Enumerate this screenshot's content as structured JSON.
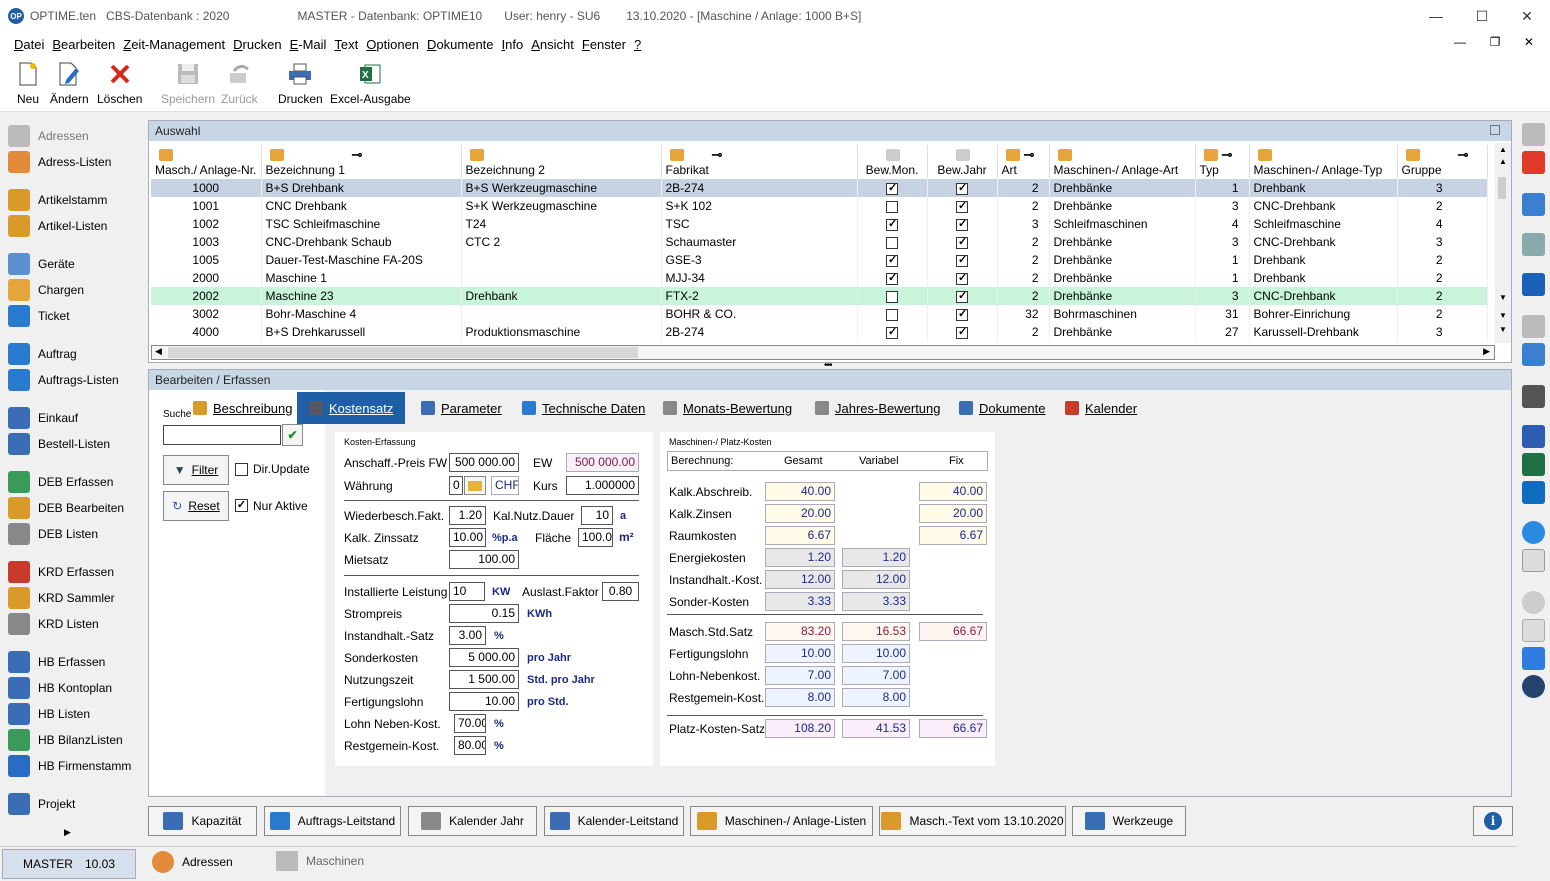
{
  "window": {
    "app": "OPTIME.ten",
    "db": "CBS-Datenbank : 2020",
    "master": "MASTER - Datenbank:  OPTIME10",
    "user": "User:  henry  -  SU6",
    "info": "13.10.2020 - [Maschine / Anlage: 1000  B+S]"
  },
  "menu": [
    "Datei",
    "Bearbeiten",
    "Zeit-Management",
    "Drucken",
    "E-Mail",
    "Text",
    "Optionen",
    "Dokumente",
    "Info",
    "Ansicht",
    "Fenster",
    "?"
  ],
  "toolbar": {
    "neu": "Neu",
    "aendern": "Ändern",
    "loeschen": "Löschen",
    "speichern": "Speichern",
    "zurueck": "Zurück",
    "drucken": "Drucken",
    "excel": "Excel-Ausgabe"
  },
  "sidebar": [
    "Adressen",
    "Adress-Listen",
    "Artikelstamm",
    "Artikel-Listen",
    "Geräte",
    "Chargen",
    "Ticket",
    "Auftrag",
    "Auftrags-Listen",
    "Einkauf",
    "Bestell-Listen",
    "DEB Erfassen",
    "DEB Bearbeiten",
    "DEB Listen",
    "KRD Erfassen",
    "KRD Sammler",
    "KRD Listen",
    "HB Erfassen",
    "HB Kontoplan",
    "HB Listen",
    "HB BilanzListen",
    "HB Firmenstamm",
    "Projekt"
  ],
  "auswahl": {
    "title": "Auswahl",
    "columns": [
      "Masch./ Anlage-Nr.",
      "Bezeichnung 1",
      "Bezeichnung 2",
      "Fabrikat",
      "Bew.Mon.",
      "Bew.Jahr",
      "Art",
      "Maschinen-/ Anlage-Art",
      "Typ",
      "Maschinen-/ Anlage-Typ",
      "Gruppe"
    ],
    "rows": [
      [
        "1000",
        "B+S Drehbank",
        "B+S Werkzeugmaschine",
        "2B-274",
        "1",
        "1",
        "2",
        "Drehbänke",
        "1",
        "Drehbank",
        "3"
      ],
      [
        "1001",
        "CNC Drehbank",
        "S+K Werkzeugmaschine",
        "S+K 102",
        "0",
        "1",
        "2",
        "Drehbänke",
        "3",
        "CNC-Drehbank",
        "2"
      ],
      [
        "1002",
        "TSC Schleifmaschine",
        "T24",
        "TSC",
        "1",
        "1",
        "3",
        "Schleifmaschinen",
        "4",
        "Schleifmaschine",
        "4"
      ],
      [
        "1003",
        "CNC-Drehbank Schaub",
        "CTC 2",
        "Schaumaster",
        "0",
        "1",
        "2",
        "Drehbänke",
        "3",
        "CNC-Drehbank",
        "3"
      ],
      [
        "1005",
        "Dauer-Test-Maschine FA-20S",
        "",
        "GSE-3",
        "1",
        "1",
        "2",
        "Drehbänke",
        "1",
        "Drehbank",
        "2"
      ],
      [
        "2000",
        "Maschine 1",
        "",
        "MJJ-34",
        "1",
        "1",
        "2",
        "Drehbänke",
        "1",
        "Drehbank",
        "2"
      ],
      [
        "2002",
        "Maschine 23",
        "Drehbank",
        "FTX-2",
        "0",
        "1",
        "2",
        "Drehbänke",
        "3",
        "CNC-Drehbank",
        "2"
      ],
      [
        "3002",
        "Bohr-Maschine 4",
        "",
        "BOHR & CO.",
        "0",
        "1",
        "32",
        "Bohrmaschinen",
        "31",
        "Bohrer-Einrichung",
        "2"
      ],
      [
        "4000",
        "B+S Drehkarussell",
        "Produktionsmaschine",
        "2B-274",
        "1",
        "1",
        "2",
        "Drehbänke",
        "27",
        "Karussell-Drehbank",
        "3"
      ]
    ]
  },
  "bearbeiten": {
    "title": "Bearbeiten / Erfassen",
    "suche": "Suche",
    "filter": "Filter",
    "dirupdate": "Dir.Update",
    "reset": "Reset",
    "nuraktive": "Nur Aktive",
    "tabs": [
      "Beschreibung",
      "Kostensatz",
      "Parameter",
      "Technische Daten",
      "Monats-Bewertung",
      "Jahres-Bewertung",
      "Dokumente",
      "Kalender"
    ]
  },
  "kosten": {
    "title": "Kosten-Erfassung",
    "anschaff_l": "Anschaff.-Preis FW",
    "anschaff": "500 000.00",
    "ew_l": "EW",
    "ew": "500 000.00",
    "waehrung_l": "Währung",
    "waehrung": "0",
    "chf": "CHF",
    "kurs_l": "Kurs",
    "kurs": "1.000000",
    "wbf_l": "Wiederbesch.Fakt.",
    "wbf": "1.20",
    "knd_l": "Kal.Nutz.Dauer",
    "knd": "10",
    "a": "a",
    "zins_l": "Kalk. Zinssatz",
    "zins": "10.00",
    "zins_u": "%p.a",
    "flaeche_l": "Fläche",
    "flaeche": "100.00",
    "m2": "m²",
    "miet_l": "Mietsatz",
    "miet": "100.00",
    "leist_l": "Installierte Leistung",
    "leist": "10",
    "kw": "KW",
    "ausl_l": "Auslast.Faktor",
    "ausl": "0.80",
    "strom_l": "Strompreis",
    "strom": "0.15",
    "kwh": "KWh",
    "inst_l": "Instandhalt.-Satz",
    "inst": "3.00",
    "pct1": "%",
    "sonder_l": "Sonderkosten",
    "sonder": "5 000.00",
    "sonder_u": "pro Jahr",
    "nutz_l": "Nutzungszeit",
    "nutz": "1 500.00",
    "nutz_u": "Std. pro Jahr",
    "fert_l": "Fertigungslohn",
    "fert": "10.00",
    "fert_u": "pro Std.",
    "lohn_l": "Lohn Neben-Kost.",
    "lohn": "70.00",
    "pct2": "%",
    "rest_l": "Restgemein-Kost.",
    "rest": "80.00",
    "pct3": "%"
  },
  "platz": {
    "title": "Maschinen-/ Platz-Kosten",
    "h_ber": "Berechnung:",
    "h_ges": "Gesamt",
    "h_var": "Variabel",
    "h_fix": "Fix",
    "rows": [
      [
        "Kalk.Abschreib.",
        "40.00",
        "",
        "40.00"
      ],
      [
        "Kalk.Zinsen",
        "20.00",
        "",
        "20.00"
      ],
      [
        "Raumkosten",
        "6.67",
        "",
        "6.67"
      ],
      [
        "Energiekosten",
        "1.20",
        "1.20",
        ""
      ],
      [
        "Instandhalt.-Kost.",
        "12.00",
        "12.00",
        ""
      ],
      [
        "Sonder-Kosten",
        "3.33",
        "3.33",
        ""
      ],
      [
        "Masch.Std.Satz",
        "83.20",
        "16.53",
        "66.67"
      ],
      [
        "Fertigungslohn",
        "10.00",
        "10.00",
        ""
      ],
      [
        "Lohn-Nebenkost.",
        "7.00",
        "7.00",
        ""
      ],
      [
        "Restgemein-Kost.",
        "8.00",
        "8.00",
        ""
      ],
      [
        "Platz-Kosten-Satz",
        "108.20",
        "41.53",
        "66.67"
      ]
    ]
  },
  "buttons": [
    "Kapazität",
    "Auftrags-Leitstand",
    "Kalender Jahr",
    "Kalender-Leitstand",
    "Maschinen-/ Anlage-Listen",
    "Masch.-Text vom 13.10.2020",
    "Werkzeuge"
  ],
  "status": {
    "master": "MASTER",
    "version": "10.03",
    "tab1": "Adressen",
    "tab2": "Maschinen"
  }
}
